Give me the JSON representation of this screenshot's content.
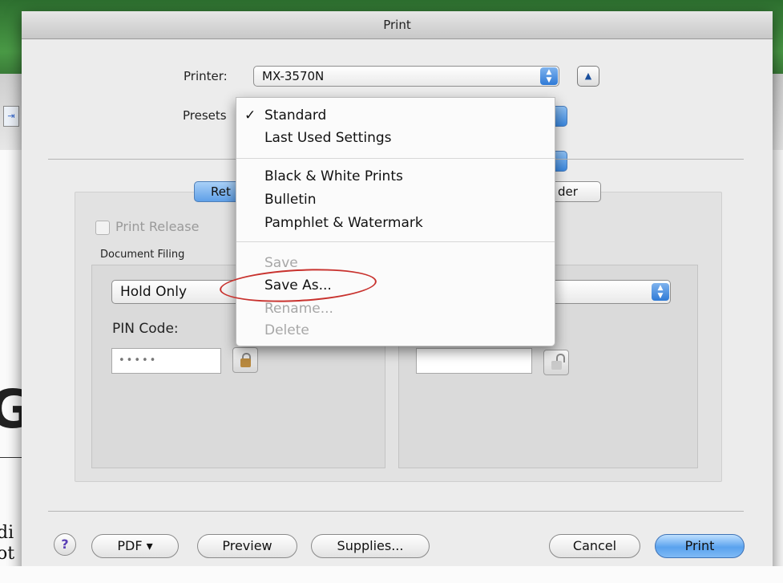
{
  "window": {
    "title": "Print"
  },
  "printer": {
    "label": "Printer:",
    "value": "MX-3570N"
  },
  "presets": {
    "label": "Presets"
  },
  "tabs": {
    "left_visible": "Ret",
    "right_visible": "der"
  },
  "release": {
    "print_release_label": "Print Release"
  },
  "document_filing": {
    "label": "Document Filing",
    "mode_value": "Hold Only",
    "pin_label": "PIN Code:",
    "pin_value": "•••••"
  },
  "menu": {
    "checked_item": "Standard",
    "items": [
      {
        "label": "Standard",
        "checked": true,
        "enabled": true
      },
      {
        "label": "Last Used Settings",
        "enabled": true
      },
      {
        "label": "Black & White Prints",
        "enabled": true
      },
      {
        "label": "Bulletin",
        "enabled": true
      },
      {
        "label": "Pamphlet & Watermark",
        "enabled": true
      },
      {
        "label": "Save",
        "enabled": false
      },
      {
        "label": "Save As...",
        "enabled": true,
        "highlighted_by": "red-oval"
      },
      {
        "label": "Rename...",
        "enabled": false
      },
      {
        "label": "Delete",
        "enabled": false
      }
    ]
  },
  "footer": {
    "help": "?",
    "pdf": "PDF ▾",
    "preview": "Preview",
    "supplies": "Supplies...",
    "cancel": "Cancel",
    "print": "Print"
  },
  "background": {
    "text_line1": "di",
    "text_line2": "ot"
  },
  "colors": {
    "accent_blue": "#5aa2ee",
    "annotation_red": "#c8322e"
  }
}
